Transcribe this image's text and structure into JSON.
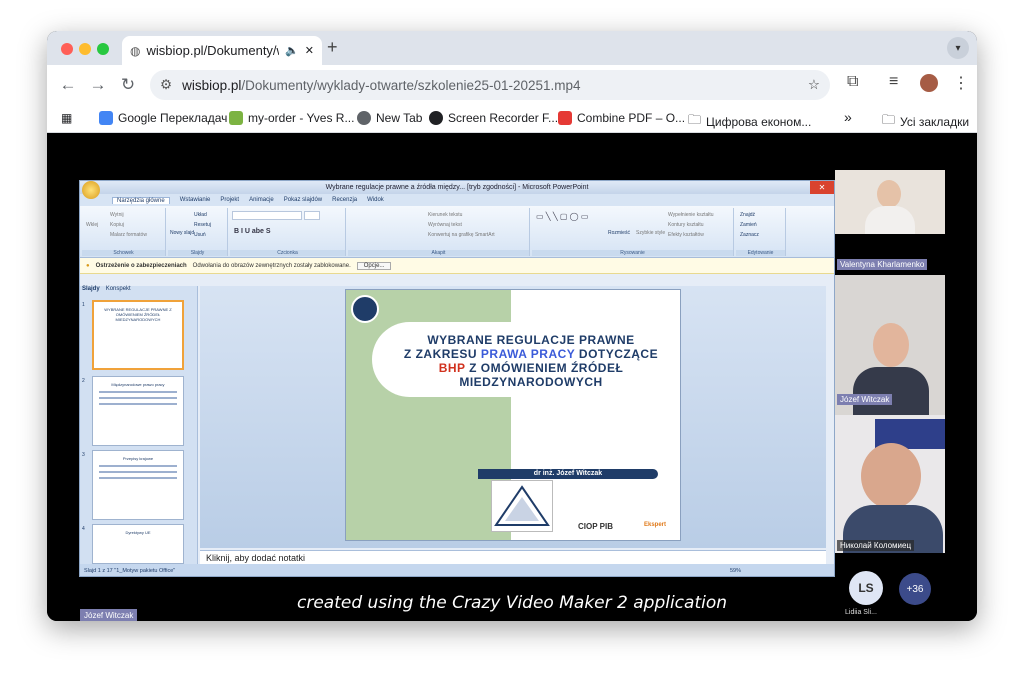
{
  "browser": {
    "tab_title": "wisbiop.pl/Dokumenty/wy",
    "new_tab_symbol": "+",
    "close_symbol": "✕",
    "url_domain": "wisbiop.pl",
    "url_path": "/Dokumenty/wyklady-otwarte/szkolenie25-01-20251.mp4",
    "bookmarks": [
      {
        "label": "Google Перекладач",
        "color": "#4285f4"
      },
      {
        "label": "my-order - Yves R...",
        "color": "#7cb342"
      },
      {
        "label": "New Tab",
        "color": "#5f6368"
      },
      {
        "label": "Screen Recorder F...",
        "color": "#202124"
      },
      {
        "label": "Combine PDF – O...",
        "color": "#e53935"
      },
      {
        "label": "Цифрова економ...",
        "color": "#5f6368"
      }
    ],
    "bookmarks_overflow": "»",
    "all_bookmarks": "Усі закладки"
  },
  "ppt": {
    "window_title": "Wybrane regulacje prawne a źródła między... [tryb zgodności] - Microsoft PowerPoint",
    "ribbon_tabs": [
      "Narzędzia główne",
      "Wstawianie",
      "Projekt",
      "Animacje",
      "Pokaz slajdów",
      "Recenzja",
      "Widok"
    ],
    "ribbon_groups": [
      "Schowek",
      "Slajdy",
      "Czcionka",
      "Akapit",
      "Rysowanie",
      "Edytowanie"
    ],
    "ribbon_buttons": {
      "cut": "Wytnij",
      "copy": "Kopiuj",
      "paste": "Wklej",
      "format_painter": "Malarz formatów",
      "layout": "Układ",
      "reset": "Resetuj",
      "delete": "Usuń",
      "new_slide": "Nowy slajd",
      "text_direction": "Kierunek tekstu",
      "align_text": "Wyrównaj tekst",
      "smartart": "Konwertuj na grafikę SmartArt",
      "arrange": "Rozmieść",
      "quick_styles": "Szybkie style",
      "shape_fill": "Wypełnienie kształtu",
      "shape_outline": "Kontury kształtu",
      "shape_effects": "Efekty kształtów",
      "find": "Znajdź",
      "replace": "Zamień",
      "select": "Zaznacz"
    },
    "security_title": "Ostrzeżenie o zabezpieczeniach",
    "security_text": "Odwołania do obrazów zewnętrznych zostały zablokowane.",
    "security_button": "Opcje...",
    "pane_tabs": [
      "Slajdy",
      "Konspekt"
    ],
    "thumbnails": [
      {
        "num": "1",
        "head": "WYBRANE REGULACJE PRAWNE Z OMÓWIENIEM ŹRÓDEŁ MIEDZYNARODOWYCH"
      },
      {
        "num": "2",
        "head": "Międzynarodowe prawo pracy"
      },
      {
        "num": "3",
        "head": "Przepisy krajowe"
      },
      {
        "num": "4",
        "head": "Dyrektywy UE"
      }
    ],
    "slide": {
      "title_l1": "WYBRANE  REGULACJE  PRAWNE",
      "title_l2_a": "Z ZAKRESU ",
      "title_l2_b": "PRAWA PRACY",
      "title_l2_c": " DOTYCZĄCE",
      "title_l3_a": "BHP",
      "title_l3_b": "   Z  OMÓWIENIEM   ŹRÓDEŁ",
      "title_l4": "MIEDZYNARODOWYCH",
      "author": "dr inż. Józef Witczak",
      "logo1": "CIOP",
      "logo1b": "PIB",
      "logo2": "Ekspert",
      "accent_blue": "#1f3c68",
      "accent_link": "#3b5bd9",
      "accent_red": "#d1321e"
    },
    "notes_placeholder": "Kliknij, aby dodać notatki",
    "status_left": "Slajd 1 z 17    \"1_Motyw pakietu Office\"",
    "zoom": "59%"
  },
  "participants": [
    {
      "name": "Valentyna Kharlamenko",
      "bg": "#e9e3dc"
    },
    {
      "name": "Józef Witczak",
      "bg": "#d9d6d3"
    },
    {
      "name": "Николай Коломиец",
      "bg": "#eae8ea"
    }
  ],
  "more_avatar": {
    "initials": "LS",
    "name": "Lidiia Sli...",
    "more": "+36"
  },
  "speaker_label": "Józef Witczak",
  "caption": "created using the Crazy Video Maker 2 application"
}
